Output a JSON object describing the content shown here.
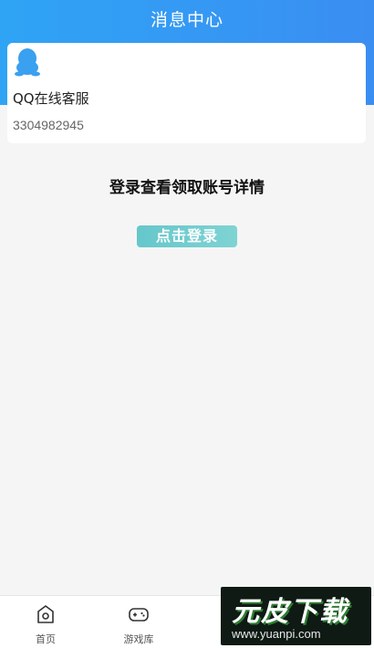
{
  "header": {
    "title": "消息中心"
  },
  "contact_card": {
    "icon": "qq-penguin-icon",
    "name": "QQ在线客服",
    "number": "3304982945"
  },
  "login_prompt": {
    "text": "登录查看领取账号详情",
    "button_label": "点击登录"
  },
  "tabbar": {
    "items": [
      {
        "label": "首页",
        "icon": "home-icon"
      },
      {
        "label": "游戏库",
        "icon": "gamepad-icon"
      }
    ]
  },
  "watermark": {
    "brand": "元皮下载",
    "url": "www.yuanpi.com"
  },
  "colors": {
    "header": "#2fa4f5",
    "login_button": "#65c7cb",
    "qq_icon": "#3aa0f0"
  }
}
